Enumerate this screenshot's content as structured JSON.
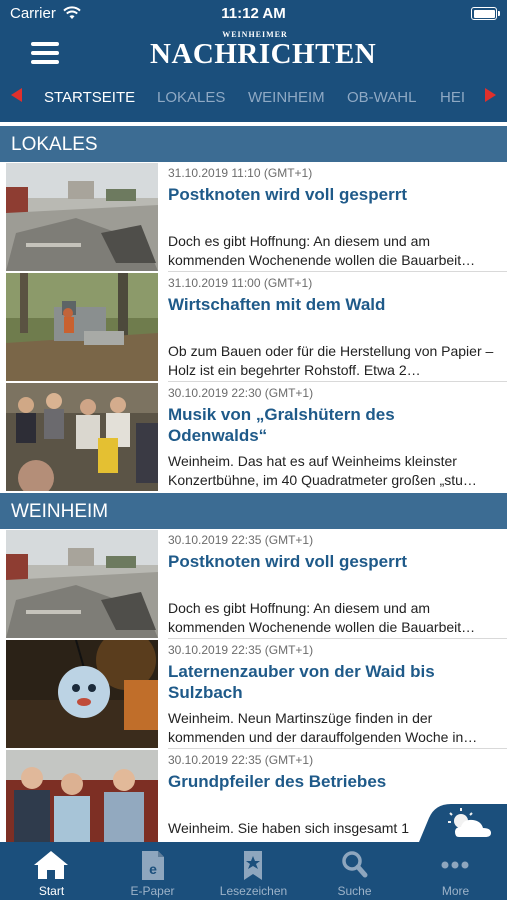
{
  "status_bar": {
    "carrier": "Carrier",
    "time": "11:12 AM"
  },
  "header": {
    "logo_small": "WEINHEIMER",
    "logo_big": "NACHRICHTEN"
  },
  "tabs": [
    {
      "label": "STARTSEITE",
      "active": true
    },
    {
      "label": "LOKALES",
      "active": false
    },
    {
      "label": "WEINHEIM",
      "active": false
    },
    {
      "label": "OB-WAHL",
      "active": false
    },
    {
      "label": "HEI",
      "active": false
    }
  ],
  "sections": [
    {
      "title": "LOKALES",
      "articles": [
        {
          "date": "31.10.2019 11:10 (GMT+1)",
          "title": "Postknoten wird voll gesperrt",
          "teaser": "Doch es gibt Hoffnung: An diesem und am kommenden Wochenende wollen die Bauarbeit…"
        },
        {
          "date": "31.10.2019 11:00 (GMT+1)",
          "title": "Wirtschaften mit dem Wald",
          "teaser": "Ob zum Bauen oder für die Herstellung von Papier – Holz ist ein begehrter Rohstoff. Etwa 2…"
        },
        {
          "date": "30.10.2019 22:30 (GMT+1)",
          "title": "Musik von „Gralshütern des Odenwalds“",
          "teaser": "Weinheim. Das hat es auf Weinheims kleinster Konzertbühne, im 40 Quadratmeter großen „stu…"
        }
      ]
    },
    {
      "title": "WEINHEIM",
      "articles": [
        {
          "date": "30.10.2019 22:35 (GMT+1)",
          "title": "Postknoten wird voll gesperrt",
          "teaser": "Doch es gibt Hoffnung: An diesem und am kommenden Wochenende wollen die Bauarbeit…"
        },
        {
          "date": "30.10.2019 22:35 (GMT+1)",
          "title": "Laternenzauber von der Waid bis Sulzbach",
          "teaser": "Weinheim. Neun Martinszüge finden in der kommenden und der darauffolgenden Woche in…"
        },
        {
          "date": "30.10.2019 22:35 (GMT+1)",
          "title": "Grundpfeiler des Betriebes",
          "teaser": "Weinheim. Sie haben sich insgesamt 1"
        }
      ]
    }
  ],
  "bottom_nav": [
    {
      "label": "Start",
      "icon": "home-icon",
      "active": true
    },
    {
      "label": "E-Paper",
      "icon": "epaper-icon",
      "active": false
    },
    {
      "label": "Lesezeichen",
      "icon": "bookmark-icon",
      "active": false
    },
    {
      "label": "Suche",
      "icon": "search-icon",
      "active": false
    },
    {
      "label": "More",
      "icon": "more-icon",
      "active": false
    }
  ],
  "colors": {
    "brand_blue": "#1b4f7c",
    "section_blue": "#3c6c93",
    "title_blue": "#1f5a89",
    "arrow_red": "#e0302c"
  }
}
